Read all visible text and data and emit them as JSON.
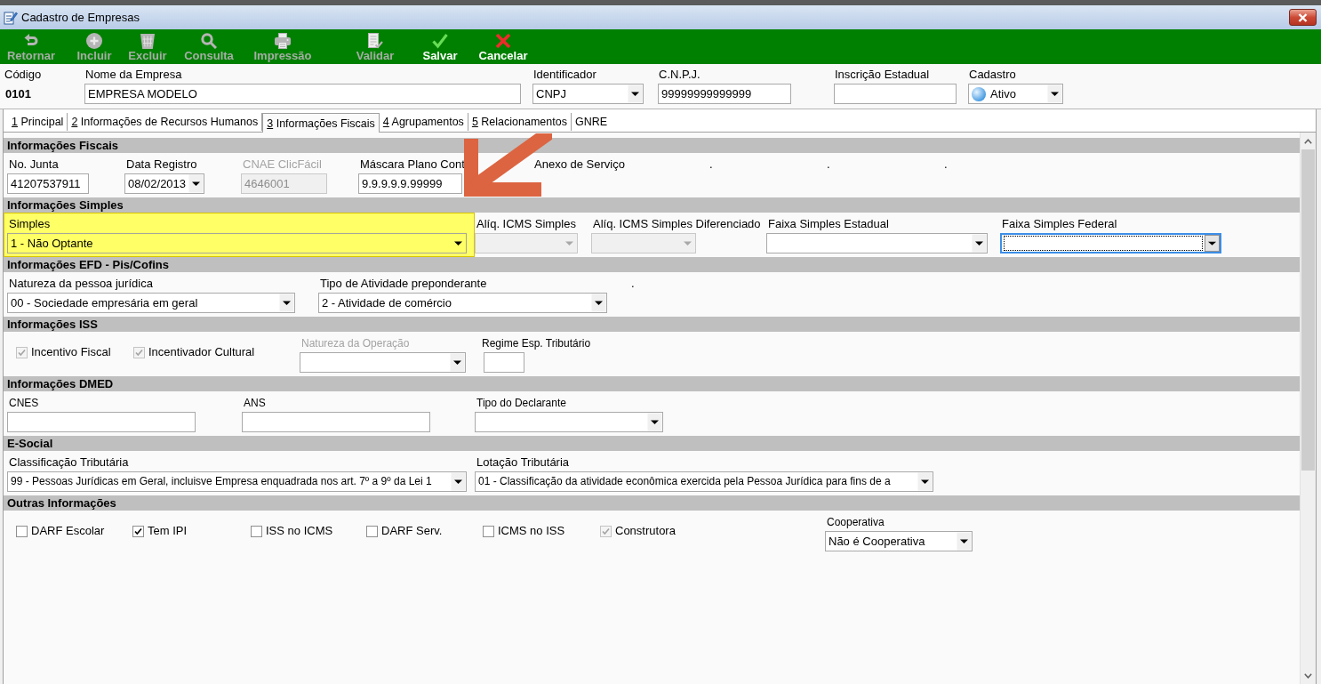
{
  "window": {
    "title": "Cadastro de Empresas"
  },
  "toolbar": [
    {
      "kind": "return",
      "label": "Retornar",
      "enabled": false
    },
    {
      "kind": "add",
      "label": "Incluir",
      "enabled": false
    },
    {
      "kind": "delete",
      "label": "Excluir",
      "enabled": false
    },
    {
      "kind": "search",
      "label": "Consulta",
      "enabled": false
    },
    {
      "kind": "print",
      "label": "Impressão",
      "enabled": false
    },
    {
      "kind": "validate",
      "label": "Validar",
      "enabled": false
    },
    {
      "kind": "save",
      "label": "Salvar",
      "enabled": true
    },
    {
      "kind": "cancel",
      "label": "Cancelar",
      "enabled": true
    }
  ],
  "header": [
    {
      "kind": "static",
      "label": "Código",
      "value": "0101"
    },
    {
      "kind": "text",
      "label": "Nome da Empresa",
      "value": "EMPRESA MODELO"
    },
    {
      "kind": "select",
      "label": "Identificador",
      "value": "CNPJ"
    },
    {
      "kind": "text",
      "label": "C.N.P.J.",
      "value": "99999999999999"
    },
    {
      "kind": "text",
      "label": "Inscrição Estadual"
    },
    {
      "kind": "status-select",
      "label": "Cadastro",
      "value": "Ativo"
    }
  ],
  "tabs": [
    {
      "key": "1",
      "label": "Principal",
      "selected": false
    },
    {
      "key": "2",
      "label": "Informações de Recursos Humanos",
      "selected": false
    },
    {
      "key": "3",
      "label": "Informações Fiscais",
      "selected": true
    },
    {
      "key": "4",
      "label": "Agrupamentos",
      "selected": false
    },
    {
      "key": "5",
      "label": "Relacionamentos",
      "selected": false
    },
    {
      "label": "GNRE",
      "selected": false
    }
  ],
  "sections": [
    {
      "title": "Informações Fiscais",
      "fields": [
        {
          "kind": "text",
          "label": "No. Junta",
          "value": "41207537911",
          "disabled": false,
          "label_disabled": false
        },
        {
          "kind": "select",
          "label": "Data Registro",
          "value": "08/02/2013",
          "disabled": false,
          "label_disabled": false
        },
        {
          "kind": "text",
          "label": "CNAE ClicFácil",
          "value": "4646001",
          "disabled": true,
          "label_disabled": true
        },
        {
          "kind": "text",
          "label": "Máscara Plano Cont",
          "value": "9.9.9.9.9.99999",
          "disabled": false,
          "label_disabled": false
        },
        {
          "kind": "label",
          "label": "Anexo de Serviço"
        },
        {
          "kind": "label",
          "label": "."
        },
        {
          "kind": "label",
          "label": "."
        },
        {
          "kind": "label",
          "label": "."
        }
      ]
    },
    {
      "title": "Informações Simples",
      "fields": [
        {
          "kind": "select",
          "label": "Simples",
          "value": "1 - Não Optante",
          "disabled": false,
          "label_disabled": false,
          "highlighted": true,
          "focused": false
        },
        {
          "kind": "select",
          "label": "Alíq. ICMS Simples",
          "disabled": true,
          "label_disabled": false,
          "highlighted": false,
          "focused": false
        },
        {
          "kind": "select",
          "label": "Alíq. ICMS Simples Diferenciado",
          "disabled": true,
          "label_disabled": false,
          "highlighted": false,
          "focused": false
        },
        {
          "kind": "select",
          "label": "Faixa Simples Estadual",
          "disabled": false,
          "label_disabled": false,
          "highlighted": false,
          "focused": false
        },
        {
          "kind": "select",
          "label": "Faixa Simples Federal",
          "disabled": false,
          "label_disabled": false,
          "highlighted": false,
          "focused": true
        }
      ]
    },
    {
      "title": "Informações EFD - Pis/Cofins",
      "fields": [
        {
          "kind": "select",
          "label": "Natureza da pessoa jurídica",
          "value": "00 - Sociedade empresária em geral",
          "disabled": false,
          "label_disabled": false
        },
        {
          "kind": "select",
          "label": "Tipo de Atividade preponderante",
          "value": "2 - Atividade de comércio",
          "disabled": false,
          "label_disabled": false
        },
        {
          "kind": "label",
          "label": "."
        }
      ]
    },
    {
      "title": "Informações ISS",
      "fields": [
        {
          "kind": "check",
          "label": "Incentivo Fiscal",
          "checked": true,
          "disabled": true
        },
        {
          "kind": "check",
          "label": "Incentivador Cultural",
          "checked": true,
          "disabled": true
        },
        {
          "kind": "select",
          "label": "Natureza da Operação",
          "disabled": false,
          "label_disabled": true
        },
        {
          "kind": "text",
          "label": "Regime Esp. Tributário",
          "disabled": false,
          "label_disabled": false
        }
      ]
    },
    {
      "title": "Informações DMED",
      "fields": [
        {
          "kind": "text",
          "label": "CNES",
          "disabled": false,
          "label_disabled": false
        },
        {
          "kind": "text",
          "label": "ANS",
          "disabled": false,
          "label_disabled": false
        },
        {
          "kind": "select",
          "label": "Tipo do Declarante",
          "disabled": false,
          "label_disabled": false
        }
      ]
    },
    {
      "title": "E-Social",
      "fields": [
        {
          "kind": "select",
          "label": "Classificação Tributária",
          "value": "99 - Pessoas Jurídicas em Geral, incluisve Empresa enquadrada nos art. 7º a 9º da Lei 1",
          "disabled": false,
          "label_disabled": false
        },
        {
          "kind": "select",
          "label": "Lotação Tributária",
          "value": "01 - Classificação da atividade econômica exercida pela Pessoa Jurídica para fins de a",
          "disabled": false,
          "label_disabled": false
        }
      ]
    },
    {
      "title": "Outras Informações",
      "fields": [
        {
          "kind": "check",
          "label": "DARF Escolar",
          "checked": false,
          "disabled": false
        },
        {
          "kind": "check",
          "label": "Tem IPI",
          "checked": true,
          "disabled": false
        },
        {
          "kind": "check",
          "label": "ISS no ICMS",
          "checked": false,
          "disabled": false
        },
        {
          "kind": "check",
          "label": "DARF Serv.",
          "checked": false,
          "disabled": false
        },
        {
          "kind": "check",
          "label": "ICMS no ISS",
          "checked": false,
          "disabled": false
        },
        {
          "kind": "check",
          "label": "Construtora",
          "checked": true,
          "disabled": true
        },
        {
          "kind": "select",
          "label": "Cooperativa",
          "value": "Não é Cooperativa",
          "disabled": false,
          "label_disabled": false
        }
      ]
    }
  ]
}
